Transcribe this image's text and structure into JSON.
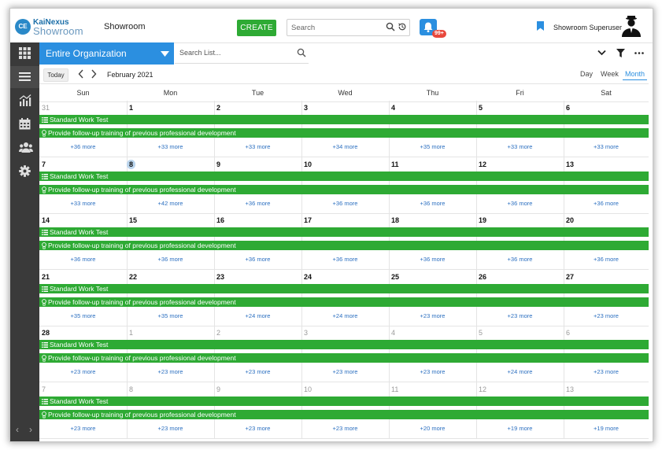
{
  "app": {
    "logo_initials": "CE",
    "brand_top": "KaiNexus",
    "brand_bottom": "Showroom",
    "name": "Showroom",
    "create_label": "CREATE",
    "search_placeholder": "Search",
    "notifications_badge": "99+",
    "user_name": "Showroom Superuser"
  },
  "sidebar": {
    "items": [
      "apps-grid-icon",
      "list-icon",
      "chart-icon",
      "calendar-icon",
      "people-icon",
      "gear-icon"
    ],
    "active_index": 1
  },
  "toolbar": {
    "org_label": "Entire Organization",
    "list_search_placeholder": "Search List..."
  },
  "calendar_nav": {
    "today_label": "Today",
    "month_label": "February 2021",
    "views": [
      "Day",
      "Week",
      "Month"
    ],
    "selected_view": "Month"
  },
  "calendar": {
    "days_of_week": [
      "Sun",
      "Mon",
      "Tue",
      "Wed",
      "Thu",
      "Fri",
      "Sat"
    ],
    "bar1_label": "Standard Work Test",
    "bar2_label": "Provide follow-up training of previous professional development",
    "today_date": "8",
    "weeks": [
      {
        "days": [
          "31",
          "1",
          "2",
          "3",
          "4",
          "5",
          "6"
        ],
        "other": [
          true,
          false,
          false,
          false,
          false,
          false,
          false
        ],
        "more": [
          "+36 more",
          "+33 more",
          "+33 more",
          "+34 more",
          "+35 more",
          "+33 more",
          "+33 more"
        ]
      },
      {
        "days": [
          "7",
          "8",
          "9",
          "10",
          "11",
          "12",
          "13"
        ],
        "other": [
          false,
          false,
          false,
          false,
          false,
          false,
          false
        ],
        "more": [
          "+33 more",
          "+42 more",
          "+36 more",
          "+36 more",
          "+36 more",
          "+36 more",
          "+36 more"
        ]
      },
      {
        "days": [
          "14",
          "15",
          "16",
          "17",
          "18",
          "19",
          "20"
        ],
        "other": [
          false,
          false,
          false,
          false,
          false,
          false,
          false
        ],
        "more": [
          "+36 more",
          "+36 more",
          "+36 more",
          "+36 more",
          "+36 more",
          "+36 more",
          "+36 more"
        ]
      },
      {
        "days": [
          "21",
          "22",
          "23",
          "24",
          "25",
          "26",
          "27"
        ],
        "other": [
          false,
          false,
          false,
          false,
          false,
          false,
          false
        ],
        "more": [
          "+35 more",
          "+35 more",
          "+24 more",
          "+24 more",
          "+23 more",
          "+23 more",
          "+23 more"
        ]
      },
      {
        "days": [
          "28",
          "1",
          "2",
          "3",
          "4",
          "5",
          "6"
        ],
        "other": [
          false,
          true,
          true,
          true,
          true,
          true,
          true
        ],
        "more": [
          "+23 more",
          "+23 more",
          "+23 more",
          "+23 more",
          "+23 more",
          "+24 more",
          "+23 more"
        ]
      },
      {
        "days": [
          "7",
          "8",
          "9",
          "10",
          "11",
          "12",
          "13"
        ],
        "other": [
          true,
          true,
          true,
          true,
          true,
          true,
          true
        ],
        "more": [
          "+23 more",
          "+23 more",
          "+23 more",
          "+23 more",
          "+20 more",
          "+19 more",
          "+19 more"
        ]
      }
    ]
  },
  "colors": {
    "accent_blue": "#2b8fe0",
    "event_green": "#2eaa34",
    "sidebar_dark": "#3a3a3a",
    "badge_red": "#e9483c"
  }
}
